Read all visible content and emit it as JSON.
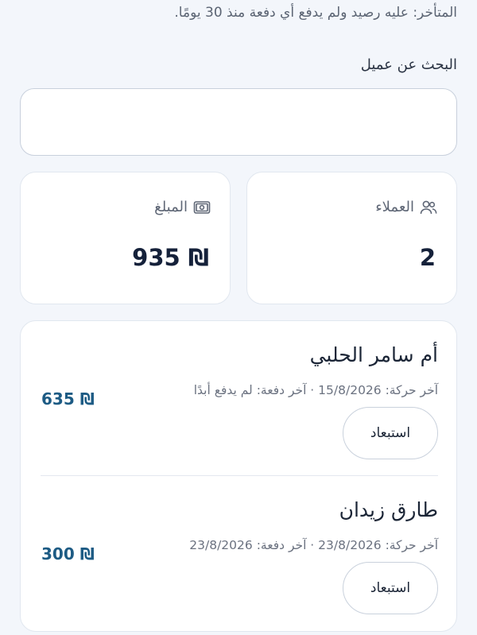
{
  "note": "المتأخر: عليه رصيد ولم يدفع أي دفعة منذ 30 يومًا.",
  "search": {
    "label": "البحث عن عميل",
    "value": "",
    "placeholder": ""
  },
  "stats": {
    "customers_label": "العملاء",
    "customers_value": "2",
    "customers_icon": "users-icon",
    "amount_label": "المبلغ",
    "amount_value": "935 ₪",
    "amount_icon": "banknote-icon"
  },
  "customers": [
    {
      "name": "أم سامر الحلبي",
      "meta": "آخر حركة: 15/8/2026 · آخر دفعة: لم يدفع أبدًا",
      "amount": "635 ₪",
      "action": "استبعاد"
    },
    {
      "name": "طارق زيدان",
      "meta": "آخر حركة: 23/8/2026 · آخر دفعة: 23/8/2026",
      "amount": "300 ₪",
      "action": "استبعاد"
    }
  ],
  "colors": {
    "background": "#f3f6fb",
    "card": "#ffffff",
    "amount_accent": "#1d5b84",
    "text": "#1b2536"
  }
}
